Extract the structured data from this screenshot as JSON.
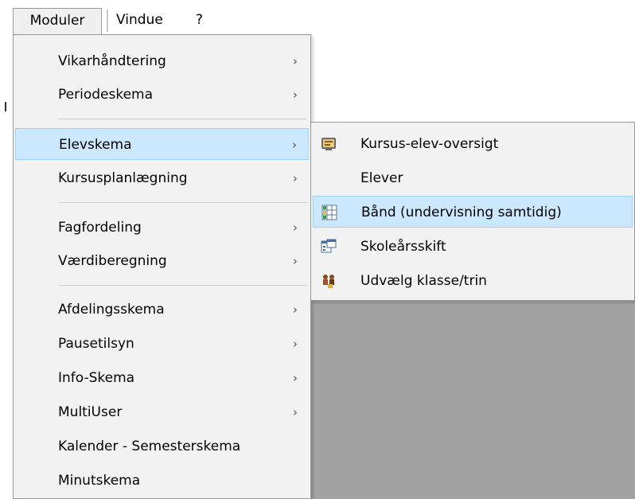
{
  "menubar": {
    "items": [
      "Moduler",
      "Vindue",
      "?"
    ]
  },
  "moduler_menu": {
    "items": [
      {
        "label": "Vikarhåndtering",
        "submenu": true
      },
      {
        "label": "Periodeskema",
        "submenu": true
      },
      {
        "label": "Elevskema",
        "submenu": true,
        "highlighted": true
      },
      {
        "label": "Kursusplanlægning",
        "submenu": true
      },
      {
        "label": "Fagfordeling",
        "submenu": true
      },
      {
        "label": "Værdiberegning",
        "submenu": true
      },
      {
        "label": "Afdelingsskema",
        "submenu": true
      },
      {
        "label": "Pausetilsyn",
        "submenu": true
      },
      {
        "label": "Info-Skema",
        "submenu": true
      },
      {
        "label": "MultiUser",
        "submenu": true
      },
      {
        "label": "Kalender - Semesterskema",
        "submenu": false
      },
      {
        "label": "Minutskema",
        "submenu": false
      }
    ],
    "arrow_glyph": "›"
  },
  "elevskema_submenu": {
    "items": [
      {
        "label": "Kursus-elev-oversigt",
        "icon": "course-student-overview-icon"
      },
      {
        "label": "Elever",
        "icon": ""
      },
      {
        "label": "Bånd (undervisning  samtidig)",
        "icon": "band-grid-icon",
        "highlighted": true
      },
      {
        "label": "Skoleårsskift",
        "icon": "school-year-change-icon"
      },
      {
        "label": "Udvælg klasse/trin",
        "icon": "select-class-icon"
      }
    ]
  },
  "colors": {
    "menu_bg": "#f2f2f2",
    "highlight_bg": "#cce8ff",
    "highlight_border": "#99d1ff",
    "workspace_gray": "#a3a3a3"
  }
}
